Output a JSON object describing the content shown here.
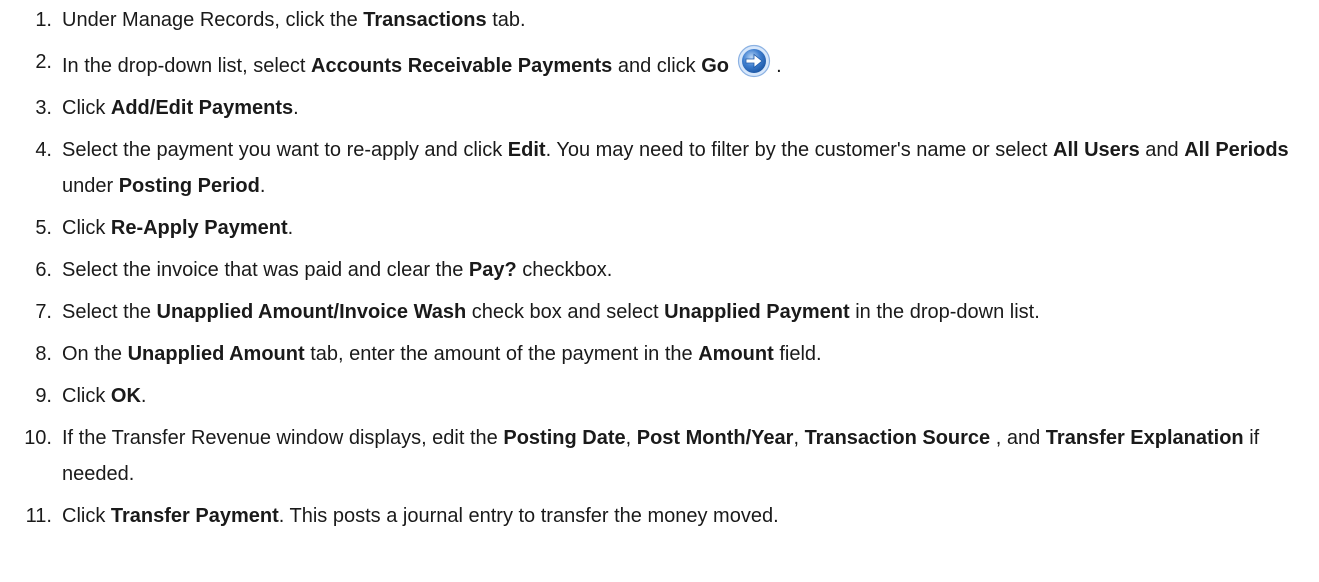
{
  "steps": [
    {
      "number": "1.",
      "parts": [
        {
          "t": "Under Manage Records, click the "
        },
        {
          "t": "Transactions",
          "b": true
        },
        {
          "t": " tab."
        }
      ]
    },
    {
      "number": "2.",
      "parts": [
        {
          "t": "In the drop-down list, select "
        },
        {
          "t": "Accounts Receivable Payments",
          "b": true
        },
        {
          "t": " and click "
        },
        {
          "t": "Go",
          "b": true
        },
        {
          "t": " "
        },
        {
          "icon": "go-arrow-icon"
        },
        {
          "t": " ."
        }
      ]
    },
    {
      "number": "3.",
      "parts": [
        {
          "t": "Click "
        },
        {
          "t": "Add/Edit Payments",
          "b": true
        },
        {
          "t": "."
        }
      ]
    },
    {
      "number": "4.",
      "parts": [
        {
          "t": "Select the payment you want to re-apply and click "
        },
        {
          "t": "Edit",
          "b": true
        },
        {
          "t": ". You may need to filter by the customer's name or select "
        },
        {
          "t": "All Users",
          "b": true
        },
        {
          "t": " and "
        },
        {
          "t": "All Periods",
          "b": true
        },
        {
          "t": " under "
        },
        {
          "t": "Posting Period",
          "b": true
        },
        {
          "t": "."
        }
      ]
    },
    {
      "number": "5.",
      "parts": [
        {
          "t": "Click "
        },
        {
          "t": "Re-Apply Payment",
          "b": true
        },
        {
          "t": "."
        }
      ]
    },
    {
      "number": "6.",
      "parts": [
        {
          "t": "Select the invoice that was paid and clear the "
        },
        {
          "t": "Pay?",
          "b": true
        },
        {
          "t": " checkbox."
        }
      ]
    },
    {
      "number": "7.",
      "parts": [
        {
          "t": "Select the "
        },
        {
          "t": "Unapplied Amount/Invoice Wash",
          "b": true
        },
        {
          "t": " check box and select "
        },
        {
          "t": "Unapplied Payment",
          "b": true
        },
        {
          "t": " in the drop-down list."
        }
      ]
    },
    {
      "number": "8.",
      "parts": [
        {
          "t": "On the "
        },
        {
          "t": "Unapplied Amount",
          "b": true
        },
        {
          "t": " tab, enter the amount of the payment in the "
        },
        {
          "t": "Amount",
          "b": true
        },
        {
          "t": " field."
        }
      ]
    },
    {
      "number": "9.",
      "parts": [
        {
          "t": "Click "
        },
        {
          "t": "OK",
          "b": true
        },
        {
          "t": "."
        }
      ]
    },
    {
      "number": "10.",
      "parts": [
        {
          "t": "If the Transfer Revenue window displays, edit the "
        },
        {
          "t": "Posting Date",
          "b": true
        },
        {
          "t": ", "
        },
        {
          "t": "Post Month/Year",
          "b": true
        },
        {
          "t": ", "
        },
        {
          "t": "Transaction Source",
          "b": true
        },
        {
          "t": " , and "
        },
        {
          "t": "Transfer Explanation",
          "b": true
        },
        {
          "t": " if needed."
        }
      ]
    },
    {
      "number": "11.",
      "parts": [
        {
          "t": "Click "
        },
        {
          "t": "Transfer Payment",
          "b": true
        },
        {
          "t": ". This posts a journal entry to transfer the money moved."
        }
      ]
    }
  ],
  "icon_colors": {
    "go_fill": "#3f7fd0",
    "go_ring": "#9fc3ee",
    "go_arrow": "#ffffff"
  }
}
